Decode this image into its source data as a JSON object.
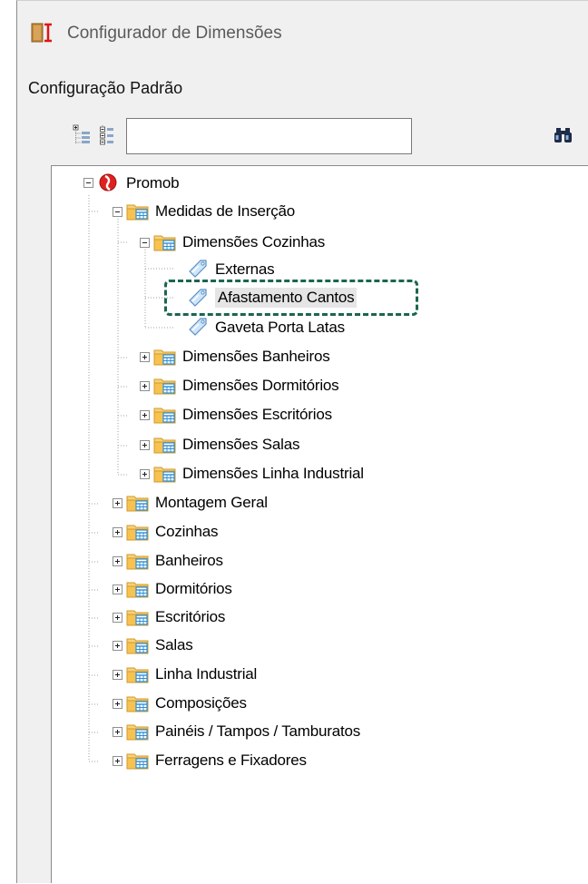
{
  "window": {
    "title": "Configurador de Dimensões",
    "section_label": "Configuração Padrão"
  },
  "toolbar": {
    "search_value": "",
    "buttons": [
      {
        "name": "expand-all-icon"
      },
      {
        "name": "collapse-all-icon"
      }
    ],
    "find_icon": "binoculars-icon"
  },
  "tree": {
    "root": "Promob",
    "medidas": "Medidas de Inserção",
    "dim_cozinhas": "Dimensões Cozinhas",
    "externas": "Externas",
    "afastamento": "Afastamento Cantos",
    "gaveta": "Gaveta Porta Latas",
    "dim_banheiros": "Dimensões Banheiros",
    "dim_dormitorios": "Dimensões Dormitórios",
    "dim_escritorios": "Dimensões Escritórios",
    "dim_salas": "Dimensões Salas",
    "dim_linha": "Dimensões Linha Industrial",
    "montagem": "Montagem Geral",
    "cozinhas": "Cozinhas",
    "banheiros": "Banheiros",
    "dormitorios": "Dormitórios",
    "escritorios": "Escritórios",
    "salas": "Salas",
    "linha": "Linha Industrial",
    "composicoes": "Composições",
    "paineis": "Painéis / Tampos / Tamburatos",
    "ferragens": "Ferragens e Fixadores"
  },
  "colors": {
    "highlight_border": "#1a6650",
    "folder": "#f4c55a",
    "table_icon": "#2f8fd6"
  }
}
